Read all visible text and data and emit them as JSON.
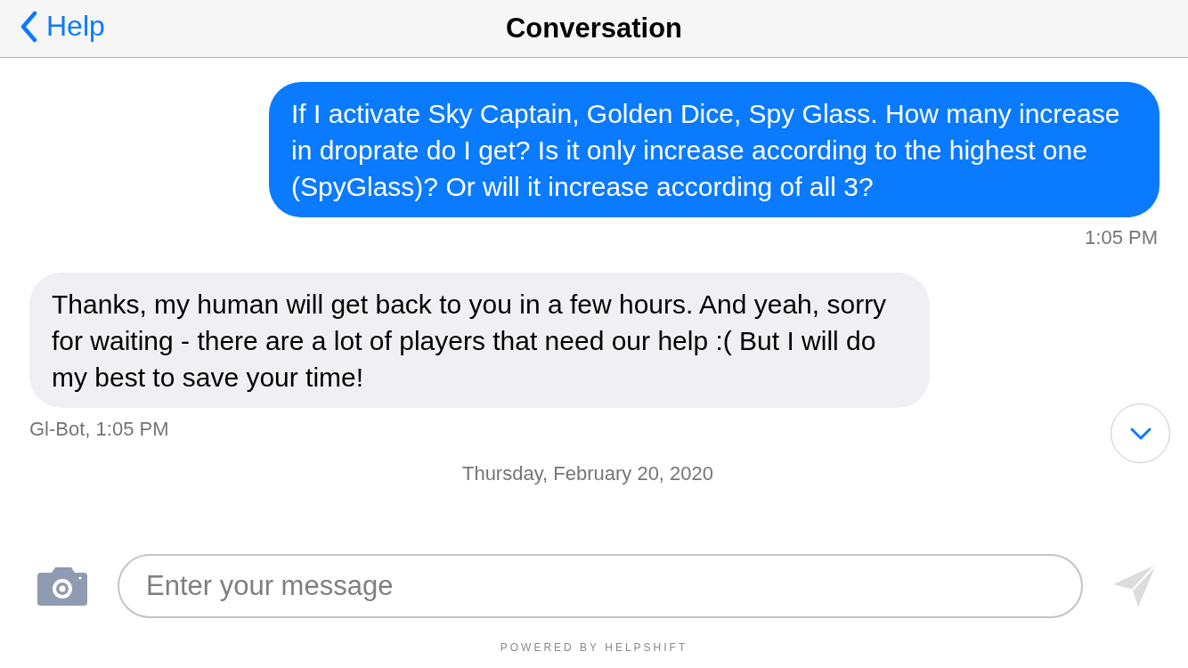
{
  "nav_bar": {
    "back_label": "Help",
    "title": "Conversation"
  },
  "messages": [
    {
      "kind": "outgoing",
      "text": "If I activate Sky Captain, Golden Dice, Spy Glass. How many increase in droprate do I get? Is it only increase according to the highest one (SpyGlass)? Or will it increase according of all 3?",
      "meta": "1:05 PM"
    },
    {
      "kind": "incoming",
      "text": "Thanks, my human will get back to you in a few hours. And yeah, sorry for waiting - there are a lot of players that need our help :( But I will do my best to save your time!",
      "meta": "Gl-Bot, 1:05 PM"
    }
  ],
  "date_separator": "Thursday, February 20, 2020",
  "composer": {
    "placeholder": "Enter your message"
  },
  "footer": "POWERED BY HELPSHIFT"
}
